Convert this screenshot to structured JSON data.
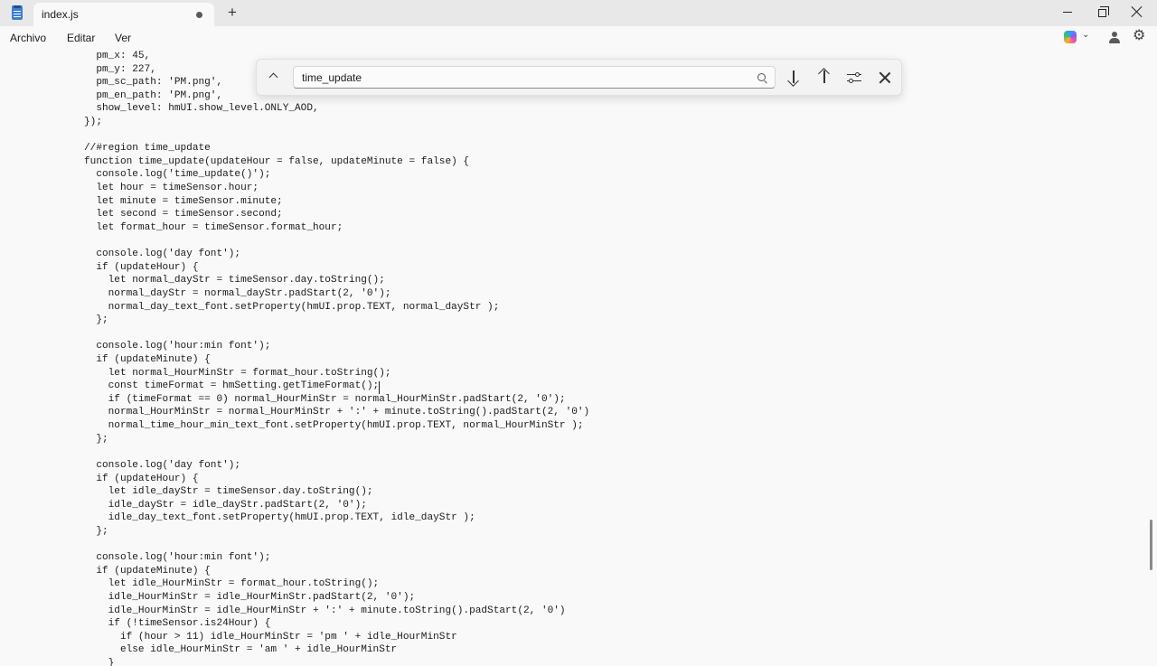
{
  "window": {
    "tab_title": "index.js",
    "new_tab_label": "+",
    "unsaved_indicator": "modified-dot"
  },
  "menu": {
    "items": [
      "Archivo",
      "Editar",
      "Ver"
    ]
  },
  "find": {
    "query": "time_update",
    "icons": [
      "chevron-up-icon",
      "search-icon",
      "arrow-down-icon",
      "arrow-up-icon",
      "filter-options-icon",
      "close-icon"
    ]
  },
  "editor": {
    "lines": [
      "  pm_x: 45,",
      "  pm_y: 227,",
      "  pm_sc_path: 'PM.png',",
      "  pm_en_path: 'PM.png',",
      "  show_level: hmUI.show_level.ONLY_AOD,",
      "});",
      "",
      "//#region time_update",
      "function time_update(updateHour = false, updateMinute = false) {",
      "  console.log('time_update()');",
      "  let hour = timeSensor.hour;",
      "  let minute = timeSensor.minute;",
      "  let second = timeSensor.second;",
      "  let format_hour = timeSensor.format_hour;",
      "",
      "  console.log('day font');",
      "  if (updateHour) {",
      "    let normal_dayStr = timeSensor.day.toString();",
      "    normal_dayStr = normal_dayStr.padStart(2, '0');",
      "    normal_day_text_font.setProperty(hmUI.prop.TEXT, normal_dayStr );",
      "  };",
      "",
      "  console.log('hour:min font');",
      "  if (updateMinute) {",
      "    let normal_HourMinStr = format_hour.toString();",
      "    const timeFormat = hmSetting.getTimeFormat();",
      "    if (timeFormat == 0) normal_HourMinStr = normal_HourMinStr.padStart(2, '0');",
      "    normal_HourMinStr = normal_HourMinStr + ':' + minute.toString().padStart(2, '0')",
      "    normal_time_hour_min_text_font.setProperty(hmUI.prop.TEXT, normal_HourMinStr );",
      "  };",
      "",
      "  console.log('day font');",
      "  if (updateHour) {",
      "    let idle_dayStr = timeSensor.day.toString();",
      "    idle_dayStr = idle_dayStr.padStart(2, '0');",
      "    idle_day_text_font.setProperty(hmUI.prop.TEXT, idle_dayStr );",
      "  };",
      "",
      "  console.log('hour:min font');",
      "  if (updateMinute) {",
      "    let idle_HourMinStr = format_hour.toString();",
      "    idle_HourMinStr = idle_HourMinStr.padStart(2, '0');",
      "    idle_HourMinStr = idle_HourMinStr + ':' + minute.toString().padStart(2, '0')",
      "    if (!timeSensor.is24Hour) {",
      "      if (hour > 11) idle_HourMinStr = 'pm ' + idle_HourMinStr",
      "      else idle_HourMinStr = 'am ' + idle_HourMinStr",
      "    }"
    ]
  },
  "colors": {
    "titlebar_bg": "#e8e8e8",
    "editor_bg": "#f9f9f9",
    "text": "#1b1b1b",
    "app_icon": "#3d7fcf"
  }
}
